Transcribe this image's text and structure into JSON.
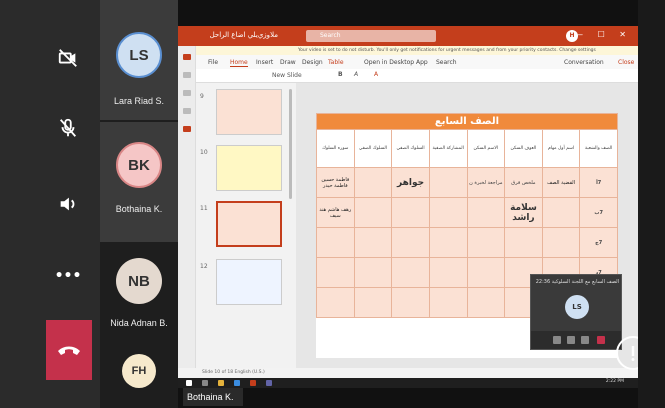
{
  "controls": {
    "camera_icon": "camera-off-icon",
    "mic_icon": "mic-off-icon",
    "speaker_icon": "speaker-icon",
    "more_label": "•••",
    "hangup_icon": "hangup-icon"
  },
  "participants": [
    {
      "initials": "LS",
      "name": "Lara Riad S.",
      "color": "#cfe0f2"
    },
    {
      "initials": "BK",
      "name": "Bothaina K.",
      "color": "#f5c6c6"
    },
    {
      "initials": "NB",
      "name": "Nida Adnan B.",
      "color": "#e4d9cf"
    },
    {
      "initials": "FH",
      "name": "",
      "color": "#f6e9cc"
    }
  ],
  "shared": {
    "title": "ملاوزي‌يلي اضاع الراحل",
    "search_placeholder": "Search",
    "user_initial": "H",
    "window_controls": "— ☐ ✕",
    "info_bar": "Your video is set to do not disturb. You'll only get notifications for urgent messages and from your priority contacts. Change settings",
    "menu": {
      "file": "File",
      "home": "Home",
      "insert": "Insert",
      "draw": "Draw",
      "design": "Design",
      "table": "Table",
      "open_desktop": "Open in Desktop App",
      "search": "Search",
      "conversation": "Conversation",
      "close": "Close"
    },
    "ribbon": {
      "new_slide": "New Slide"
    },
    "thumb_numbers": [
      "9",
      "10",
      "11",
      "12"
    ],
    "status_text": "Slide 10 of 18     English (U.S.)",
    "clock": "2:22 PM"
  },
  "slide": {
    "title": "الصف السابع",
    "headers": [
      "الصف والشعبة",
      "اسم أول مهام",
      "العوف السكن",
      "الاسم السكن",
      "المشاركة الصفية",
      "السلوك الصفي",
      "السلوك الصفي",
      "سوره السلوك"
    ],
    "rows": [
      {
        "num": "7أ",
        "cells": [
          "القضية الصف",
          "ملخص فرق",
          "مراجعة لخبرة ن",
          "",
          "جواهر",
          "",
          "فاطمة حسين فاطمة حيدر"
        ]
      },
      {
        "num": "7ب",
        "cells": [
          "",
          "سلامة راشد",
          "",
          "",
          "",
          "",
          "رهف هاشم هند سيف"
        ]
      },
      {
        "num": "7ج",
        "cells": [
          "",
          "",
          "",
          "",
          "",
          "",
          ""
        ]
      },
      {
        "num": "7د",
        "cells": [
          "",
          "",
          "",
          "",
          "",
          "",
          ""
        ]
      },
      {
        "num": "",
        "cells": [
          "",
          "",
          "",
          "",
          "",
          "",
          ""
        ]
      },
      {
        "num": "",
        "cells": [
          "",
          "",
          "",
          "",
          "",
          "",
          ""
        ]
      }
    ]
  },
  "mini_call": {
    "title": "الصف السابع مع اللجنة السلوكية",
    "timer": "22:36",
    "initials": "LS"
  },
  "presenter_label": "Bothaina K."
}
